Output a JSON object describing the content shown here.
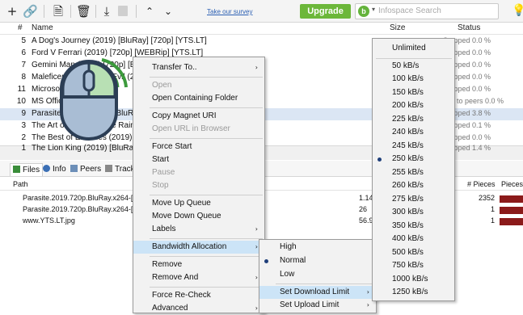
{
  "toolbar": {
    "icons": [
      "plus-icon",
      "link-icon",
      "file-icon",
      "trash-icon",
      "download-icon",
      "stop-icon",
      "chevron-up-icon",
      "chevron-down-icon"
    ],
    "survey_link": "Take our survey",
    "upgrade_label": "Upgrade",
    "search_placeholder": "Infospace Search",
    "search_logo": "b"
  },
  "list": {
    "headers": {
      "num": "#",
      "name": "Name",
      "size": "Size",
      "status": "Status"
    },
    "rows": [
      {
        "num": "5",
        "name": "A Dog's Journey (2019) [BluRay] [720p] [YTS.LT]",
        "size": "",
        "status": "Stopped 0.0 %"
      },
      {
        "num": "6",
        "name": "Ford V Ferrari (2019) [720p] [WEBRip] [YTS.LT]",
        "size": "",
        "status": "Stopped 0.0 %"
      },
      {
        "num": "7",
        "name": "Gemini Man (2019) [720p] [BluRay] [YTS.LT]",
        "size": "",
        "status": "Stopped 0.0 %"
      },
      {
        "num": "8",
        "name": "Maleficent Mistress of Evil (2019) [720p]",
        "size": "",
        "status": "Stopped 0.0 %"
      },
      {
        "num": "11",
        "name": "Microsoft Office 2019",
        "size": "",
        "status": "Stopped 0.0 %"
      },
      {
        "num": "10",
        "name": "MS Office 2016",
        "size": "",
        "status": "ting to peers 0.0 %"
      },
      {
        "num": "9",
        "name": "Parasite (2019) [720p] [BluRay] [YTS.LT]",
        "size": "",
        "status": "Stopped 3.8 %"
      },
      {
        "num": "3",
        "name": "The Art of Racing in the Rain (2019)",
        "size": "",
        "status": "Stopped 0.1 %"
      },
      {
        "num": "2",
        "name": "The Best of Enemies (2019)",
        "size": "",
        "status": "Stopped 0.0 %"
      },
      {
        "num": "1",
        "name": "The Lion King (2019) [BluRay] [YTS.LT]",
        "size": "",
        "status": "Stopped 1.4 %"
      }
    ]
  },
  "tabs": [
    {
      "label": "Files",
      "icon": "files-icon"
    },
    {
      "label": "Info",
      "icon": "info-icon"
    },
    {
      "label": "Peers",
      "icon": "peers-icon"
    },
    {
      "label": "Tracke",
      "icon": "trackers-icon"
    }
  ],
  "files": {
    "headers": {
      "path": "Path",
      "pieces": "# Pieces",
      "pieces_bar": "Pieces"
    },
    "rows": [
      {
        "path": "Parasite.2019.720p.BluRay.x264-[Y",
        "size": "1.14",
        "pieces": "2352"
      },
      {
        "path": "Parasite.2019.720p.BluRay.x264-[Y",
        "size": "26",
        "pieces": "1"
      },
      {
        "path": "www.YTS.LT.jpg",
        "size": "56.9",
        "pieces": "1"
      }
    ]
  },
  "context_menu": {
    "items": [
      {
        "label": "Transfer To..",
        "disabled": false,
        "submenu": true
      },
      {
        "sep": true
      },
      {
        "label": "Open",
        "disabled": true
      },
      {
        "label": "Open Containing Folder",
        "disabled": false
      },
      {
        "sep": true
      },
      {
        "label": "Copy Magnet URI",
        "disabled": false
      },
      {
        "label": "Open URL in Browser",
        "disabled": true
      },
      {
        "sep": true
      },
      {
        "label": "Force Start",
        "disabled": false
      },
      {
        "label": "Start",
        "disabled": false
      },
      {
        "label": "Pause",
        "disabled": true
      },
      {
        "label": "Stop",
        "disabled": true
      },
      {
        "sep": true
      },
      {
        "label": "Move Up Queue",
        "disabled": false
      },
      {
        "label": "Move Down Queue",
        "disabled": false
      },
      {
        "label": "Labels",
        "disabled": false,
        "submenu": true
      },
      {
        "sep": true
      },
      {
        "label": "Bandwidth Allocation",
        "disabled": false,
        "submenu": true,
        "highlighted": true
      },
      {
        "sep": true
      },
      {
        "label": "Remove",
        "disabled": false
      },
      {
        "label": "Remove And",
        "disabled": false,
        "submenu": true
      },
      {
        "sep": true
      },
      {
        "label": "Force Re-Check",
        "disabled": false
      },
      {
        "label": "Advanced",
        "disabled": false,
        "submenu": true
      }
    ]
  },
  "bandwidth_menu": {
    "items": [
      {
        "label": "High",
        "selected": false
      },
      {
        "label": "Normal",
        "selected": true
      },
      {
        "label": "Low",
        "selected": false
      },
      {
        "sep": true
      },
      {
        "label": "Set Download Limit",
        "submenu": true,
        "highlighted": true
      },
      {
        "label": "Set Upload Limit",
        "submenu": true
      }
    ]
  },
  "download_limit_menu": {
    "items": [
      {
        "label": "Unlimited",
        "selected": false
      },
      {
        "sep": true
      },
      {
        "label": "50 kB/s"
      },
      {
        "label": "100 kB/s"
      },
      {
        "label": "150 kB/s"
      },
      {
        "label": "200 kB/s"
      },
      {
        "label": "225 kB/s"
      },
      {
        "label": "240 kB/s"
      },
      {
        "label": "245 kB/s"
      },
      {
        "label": "250 kB/s",
        "selected": true
      },
      {
        "label": "255 kB/s"
      },
      {
        "label": "260 kB/s"
      },
      {
        "label": "275 kB/s"
      },
      {
        "label": "300 kB/s"
      },
      {
        "label": "350 kB/s"
      },
      {
        "label": "400 kB/s"
      },
      {
        "label": "500 kB/s"
      },
      {
        "label": "750 kB/s"
      },
      {
        "label": "1000 kB/s"
      },
      {
        "label": "1250 kB/s"
      }
    ]
  },
  "colors": {
    "upgrade": "#6cb73a",
    "selection": "#dbe6f4",
    "menu_highlight": "#cce4f7",
    "piece_bar": "#8b1a1a",
    "mouse_body": "#a9bdd4",
    "mouse_button": "#b8e0b4"
  }
}
